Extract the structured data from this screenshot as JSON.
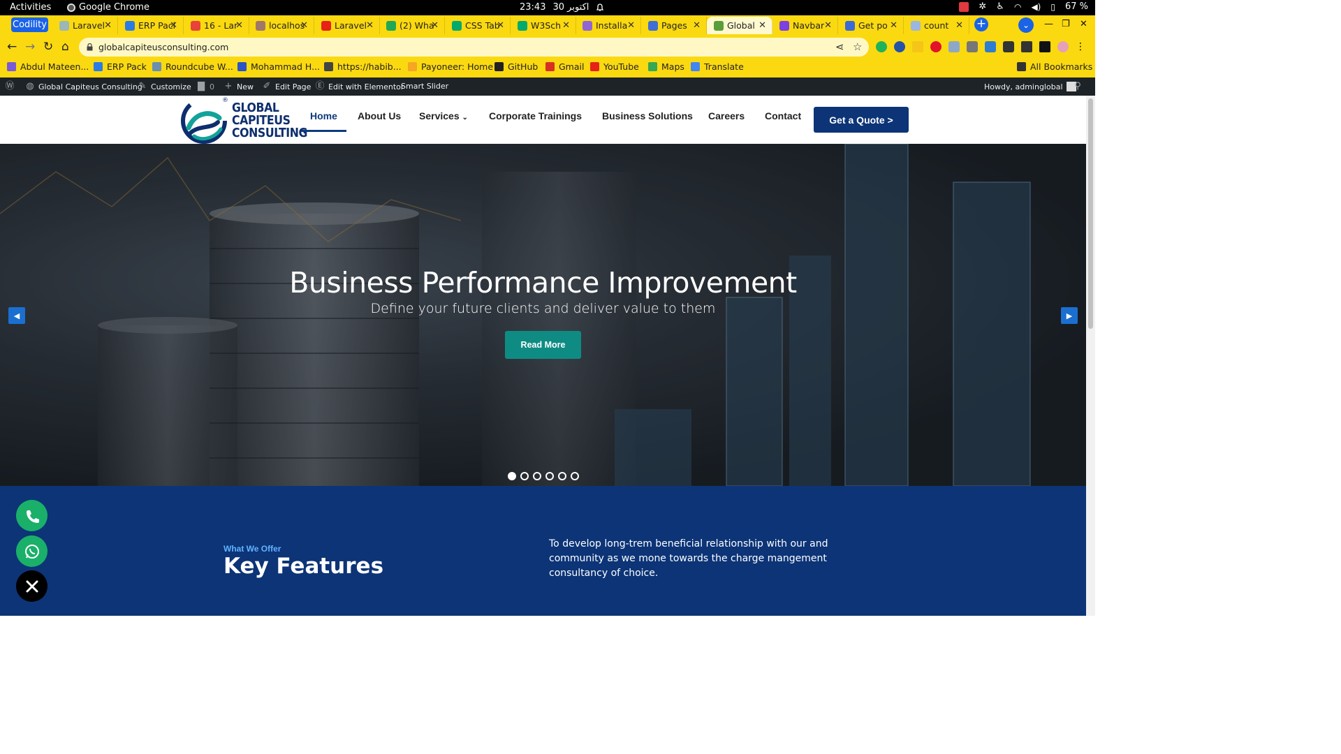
{
  "system": {
    "activities": "Activities",
    "app_name": "Google Chrome",
    "clock_time": "23:43",
    "clock_date": "30 اکتوبر",
    "battery": "67 %"
  },
  "tabs": [
    {
      "label": "Codility"
    },
    {
      "label": "Laravel",
      "color": "#9bb7b8"
    },
    {
      "label": "ERP Pack",
      "color": "#2b7be4"
    },
    {
      "label": "16 - Lar",
      "color": "#e8423b"
    },
    {
      "label": "localhost",
      "color": "#a0786a"
    },
    {
      "label": "Laravel",
      "color": "#e62117"
    },
    {
      "label": "(2) Wha",
      "color": "#1fa855"
    },
    {
      "label": "CSS Tab",
      "color": "#04aa6d"
    },
    {
      "label": "W3Sch",
      "color": "#04aa6d"
    },
    {
      "label": "Installa",
      "color": "#8f65d6"
    },
    {
      "label": "Pages",
      "color": "#3d6fd6"
    },
    {
      "label": "Global",
      "color": "#5a9e3a"
    },
    {
      "label": "Navbar",
      "color": "#7b3fe4"
    },
    {
      "label": "Get po",
      "color": "#3b6ad6"
    },
    {
      "label": "count",
      "color": "#9bb7e0"
    }
  ],
  "browser": {
    "url": "globalcapiteusconsulting.com",
    "new_tab": "+",
    "all_bookmarks": "All Bookmarks"
  },
  "bookmarks": [
    {
      "label": "Abdul Mateen...",
      "color": "#7a5ad6"
    },
    {
      "label": "ERP Pack",
      "color": "#2b7be4"
    },
    {
      "label": "Roundcube W...",
      "color": "#6a8fb0"
    },
    {
      "label": "Mohammad H...",
      "color": "#2a55c4"
    },
    {
      "label": "https://habib...",
      "color": "#444444"
    },
    {
      "label": "Payoneer: Home",
      "color": "#f5a623"
    },
    {
      "label": "GitHub",
      "color": "#222222"
    },
    {
      "label": "Gmail",
      "color": "#d93025"
    },
    {
      "label": "YouTube",
      "color": "#e62117"
    },
    {
      "label": "Maps",
      "color": "#34a853"
    },
    {
      "label": "Translate",
      "color": "#4285f4"
    }
  ],
  "wp_admin": {
    "site": "Global Capiteus Consulting",
    "customize": "Customize",
    "comments": "0",
    "new": "New",
    "edit_page": "Edit Page",
    "elementor": "Edit with Elementor",
    "slider": "Smart Slider",
    "howdy": "Howdy, adminglobal"
  },
  "site": {
    "logo_line1": "GLOBAL",
    "logo_line2": "CAPITEUS",
    "logo_line3": "CONSULTING",
    "logo_reg": "®",
    "nav": [
      "Home",
      "About Us",
      "Services",
      "Corporate Trainings",
      "Business Solutions",
      "Careers",
      "Contact"
    ],
    "quote_button": "Get a Quote >",
    "colors": {
      "brand_navy": "#0c3477",
      "brand_teal": "#0e8c84"
    }
  },
  "hero": {
    "title": "Business Performance Improvement",
    "subtitle": "Define your future clients and deliver value to them",
    "button": "Read More",
    "slides_total": 6,
    "active_slide": 1
  },
  "features": {
    "eyebrow": "What We Offer",
    "title": "Key Features",
    "text": "To develop long-trem beneficial relationship with our and community as we mone towards the charge mangement consultancy of choice."
  }
}
